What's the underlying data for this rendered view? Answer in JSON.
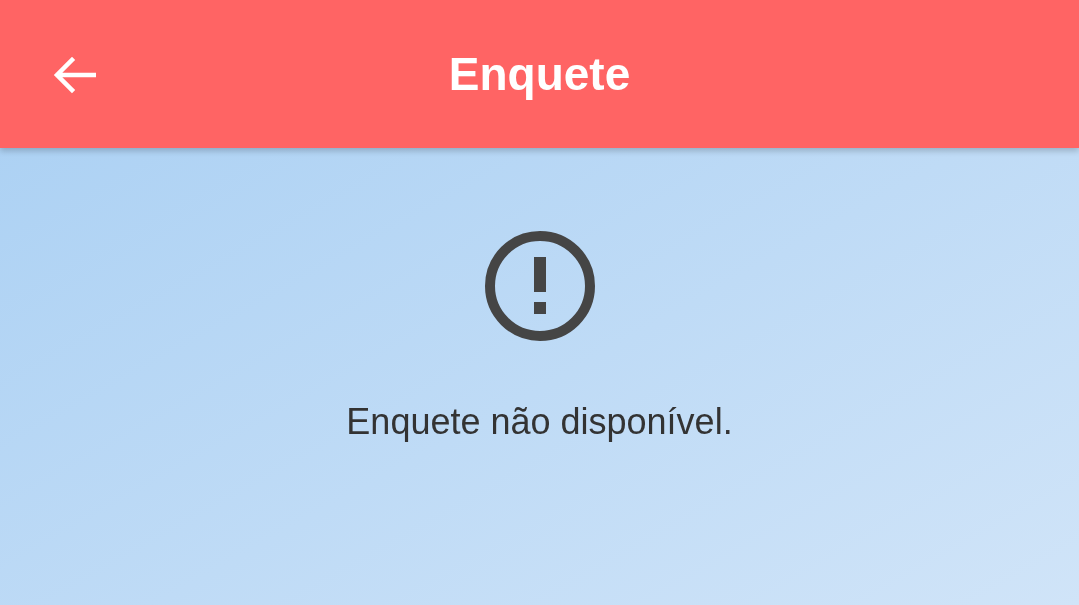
{
  "app_bar": {
    "title": "Enquete"
  },
  "message": {
    "text": "Enquete não disponível."
  }
}
